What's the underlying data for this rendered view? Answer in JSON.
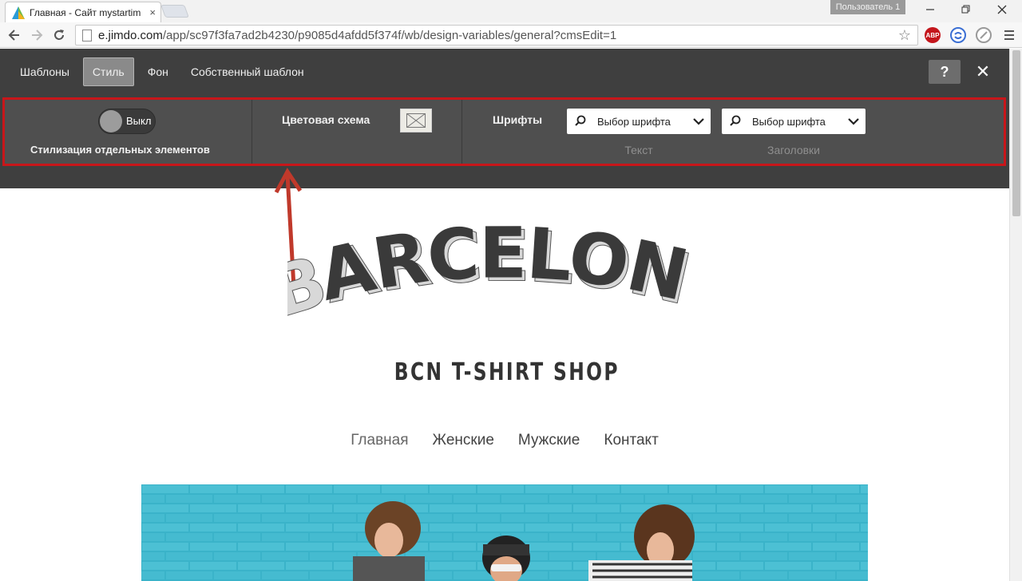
{
  "browser": {
    "tab_title": "Главная - Сайт mystartim",
    "tab_close": "×",
    "user_badge": "Пользователь 1",
    "url_host": "e.jimdo.com",
    "url_path": "/app/sc97f3fa7ad2b4230/p9085d4afdd5f374f/wb/design-variables/general?cmsEdit=1",
    "extensions": [
      {
        "name": "adblock-plus-icon",
        "label": "ABP",
        "color": "#c4161c"
      },
      {
        "name": "sync-icon",
        "label": "",
        "color": "#3b6fd4"
      },
      {
        "name": "compass-icon",
        "label": "",
        "color": "#9a9a9a"
      }
    ]
  },
  "editor": {
    "tabs": [
      {
        "label": "Шаблоны",
        "active": false
      },
      {
        "label": "Стиль",
        "active": true
      },
      {
        "label": "Фон",
        "active": false
      },
      {
        "label": "Собственный шаблон",
        "active": false
      }
    ],
    "help_label": "?",
    "close_label": "✕",
    "style_toggle_label": "Выкл",
    "style_elements_label": "Стилизация отдельных элементов",
    "color_scheme_label": "Цветовая схема",
    "fonts_label": "Шрифты",
    "font_text_select": "Выбор шрифта",
    "font_heading_select": "Выбор шрифта",
    "font_text_caption": "Текст",
    "font_heading_caption": "Заголовки",
    "highlight_color": "#c8161a"
  },
  "page": {
    "logo_text": "BARCELONA",
    "subtitle": "BCN T-SHIRT SHOP",
    "nav": [
      "Главная",
      "Женские",
      "Мужские",
      "Контакт"
    ],
    "hero_color": "#3ab3c9"
  }
}
